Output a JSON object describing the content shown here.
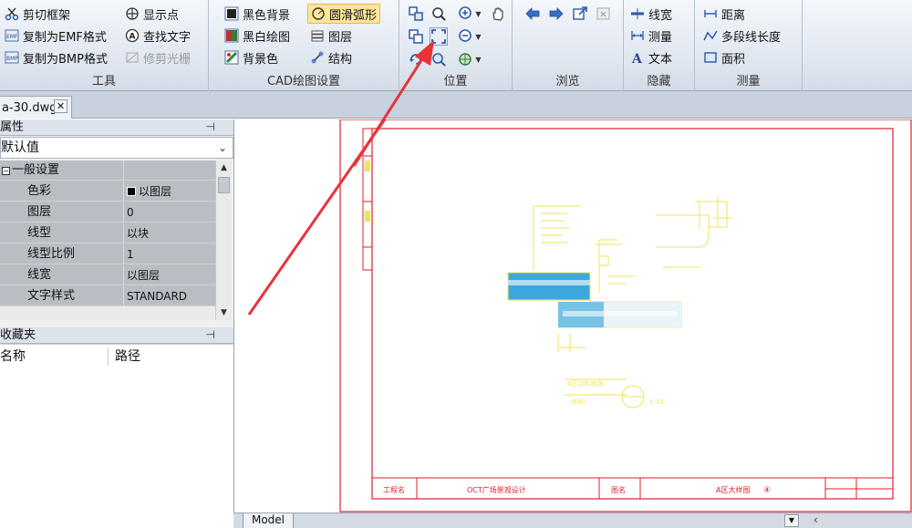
{
  "ribbon": {
    "tools_group": {
      "label": "工具",
      "clip_frame": "剪切框架",
      "copy_emf": "复制为EMF格式",
      "copy_bmp": "复制为BMP格式",
      "show_points": "显示点",
      "find_text": "查找文字",
      "trim_raster": "修剪光栅"
    },
    "cad_settings_group": {
      "label": "CAD绘图设置",
      "black_background": "黑色背景",
      "black_white_drawing": "黑白绘图",
      "background_color": "背景色",
      "smooth_arc": "圆滑弧形",
      "layers": "图层",
      "structure": "结构"
    },
    "position_group": {
      "label": "位置"
    },
    "browse_group": {
      "label": "浏览"
    },
    "hide_group": {
      "label": "隐藏",
      "line_width": "线宽",
      "measure": "测量",
      "text": "文本"
    },
    "measure_group": {
      "label": "测量",
      "distance": "距离",
      "polyline_length": "多段线长度",
      "area": "面积"
    }
  },
  "document_tab": {
    "title": "a-30.dwg"
  },
  "properties_panel": {
    "title": "属性",
    "combo_value": "默认值",
    "category": "一般设置",
    "rows": [
      {
        "name": "色彩",
        "value": "以图层"
      },
      {
        "name": "图层",
        "value": "0"
      },
      {
        "name": "线型",
        "value": "以块"
      },
      {
        "name": "线型比例",
        "value": "1"
      },
      {
        "name": "线宽",
        "value": "以图层"
      },
      {
        "name": "文字样式",
        "value": "STANDARD"
      }
    ]
  },
  "favorites_panel": {
    "title": "收藏夹",
    "col_name": "名称",
    "col_path": "路径"
  },
  "drawing": {
    "title_block": {
      "project_label": "工程名",
      "project_name": "OCT广场景观设计",
      "drawing_label": "图名",
      "drawing_name": "A区大样图",
      "drawing_number": "④"
    },
    "detail_label": "A区台阶剖面",
    "detail_sub": "(参照)",
    "scale": "1:10"
  },
  "bottom": {
    "model_tab": "Model"
  },
  "colors": {
    "annotation_arrow": "#e8333a",
    "drawing_frame": "#e01f2a",
    "cad_yellow": "#f2e35a",
    "hatch_blue": "#1a9ad8"
  },
  "icons": [
    "scissors-icon",
    "crosshair-icon",
    "magnifier-icon",
    "pan-hand-icon",
    "arrow-left-icon",
    "arrow-right-icon"
  ]
}
